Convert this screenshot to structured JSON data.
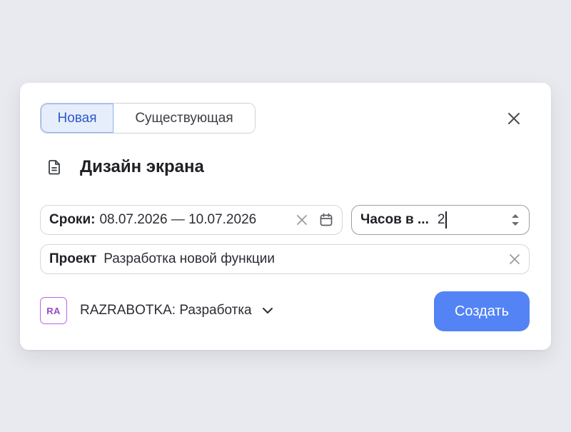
{
  "dialog": {
    "tabs": [
      {
        "label": "Новая",
        "active": true
      },
      {
        "label": "Существующая",
        "active": false
      }
    ],
    "close_icon": "close-icon",
    "doc_icon": "document-icon",
    "title": "Дизайн экрана",
    "dates": {
      "label": "Сроки:",
      "value": "08.07.2026 — 10.07.2026",
      "clear_icon": "clear-icon",
      "calendar_icon": "calendar-icon"
    },
    "hours": {
      "label": "Часов в ...",
      "value": "2",
      "stepper_icon": "up-down-stepper-icon"
    },
    "project": {
      "label": "Проект",
      "value": "Разработка новой функции",
      "clear_icon": "clear-icon"
    },
    "queue": {
      "avatar": "RA",
      "label": "RAZRABOTKA: Разработка",
      "chevron_icon": "chevron-down-icon"
    },
    "create_label": "Создать",
    "colors": {
      "accent": "#5383f5",
      "active_tab_bg": "#e6eefc",
      "active_tab_text": "#2f58c9",
      "avatar_border": "#b566e0"
    }
  }
}
